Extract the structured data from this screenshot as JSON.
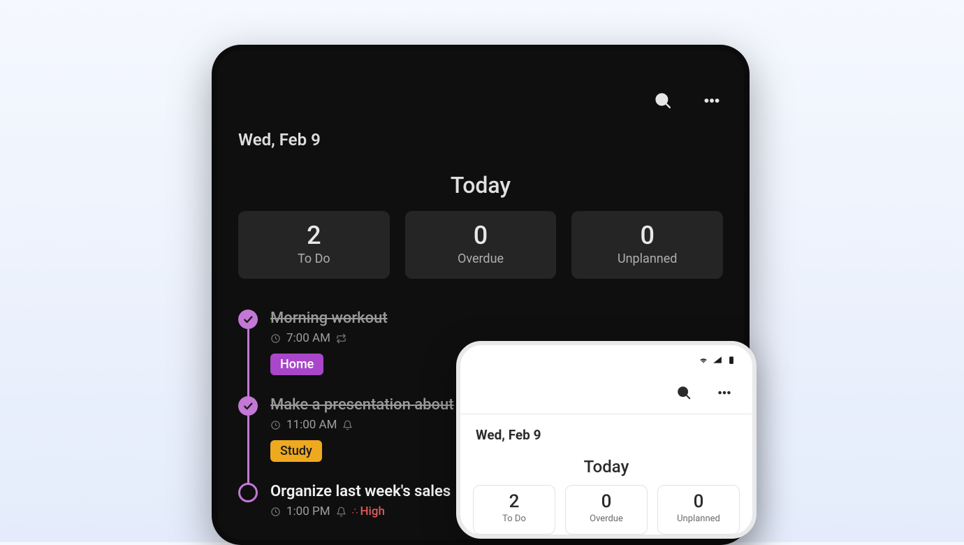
{
  "dark": {
    "date": "Wed, Feb 9",
    "today_title": "Today",
    "stats": [
      {
        "count": "2",
        "label": "To Do"
      },
      {
        "count": "0",
        "label": "Overdue"
      },
      {
        "count": "0",
        "label": "Unplanned"
      }
    ],
    "tasks": [
      {
        "title": "Morning workout",
        "done": true,
        "time": "7:00 AM",
        "has_repeat": true,
        "has_bell": false,
        "tag": {
          "text": "Home",
          "kind": "home"
        },
        "priority": null
      },
      {
        "title": "Make a presentation about",
        "done": true,
        "time": "11:00 AM",
        "has_repeat": false,
        "has_bell": true,
        "tag": {
          "text": "Study",
          "kind": "study"
        },
        "priority": null
      },
      {
        "title": "Organize last week's sales",
        "done": false,
        "time": "1:00 PM",
        "has_repeat": false,
        "has_bell": true,
        "tag": null,
        "priority": "High"
      }
    ]
  },
  "light": {
    "date": "Wed, Feb 9",
    "today_title": "Today",
    "stats": [
      {
        "count": "2",
        "label": "To Do"
      },
      {
        "count": "0",
        "label": "Overdue"
      },
      {
        "count": "0",
        "label": "Unplanned"
      }
    ]
  }
}
